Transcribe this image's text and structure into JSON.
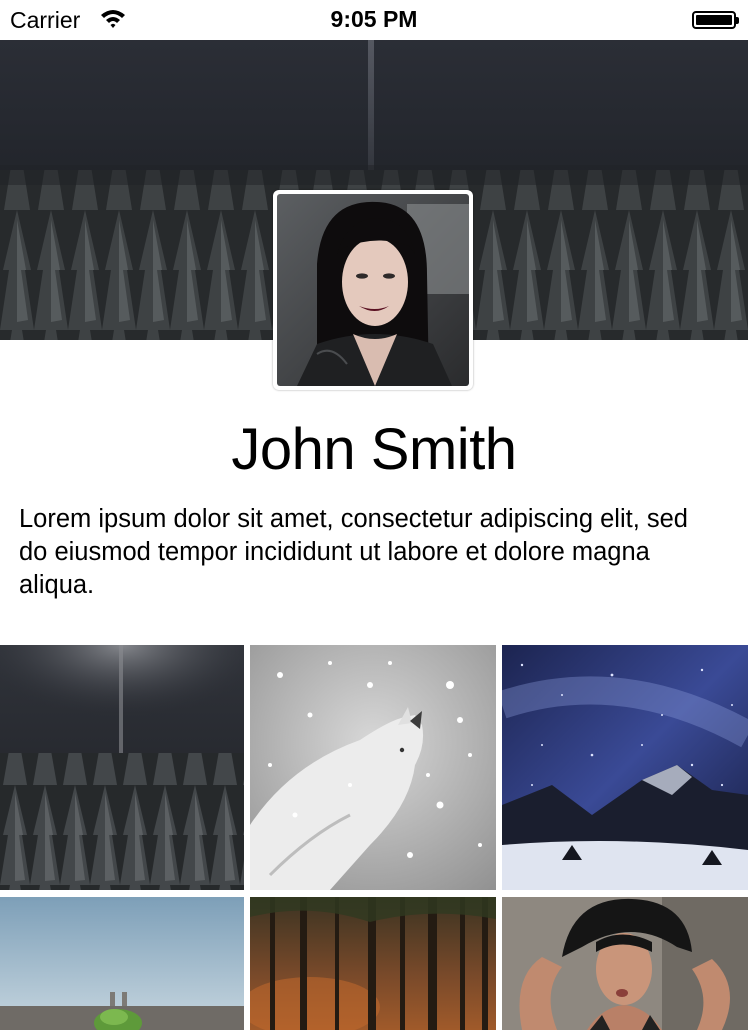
{
  "status_bar": {
    "carrier": "Carrier",
    "time": "9:05 PM",
    "wifi_icon": "wifi-icon",
    "battery_icon": "battery-icon",
    "battery_level_percent": 100
  },
  "profile": {
    "cover_image": "snowy-forest-night",
    "avatar_image": "woman-portrait",
    "name": "John Smith",
    "bio": "Lorem ipsum dolor sit amet, consectetur adipiscing elit, sed do eiusmod tempor incididunt ut labore et dolore magna aliqua."
  },
  "photos": [
    {
      "subject": "snowy-forest-night"
    },
    {
      "subject": "cat-in-snow"
    },
    {
      "subject": "starry-night-mountains"
    },
    {
      "subject": "building-sky"
    },
    {
      "subject": "autumn-forest"
    },
    {
      "subject": "woman-hat"
    }
  ],
  "colors": {
    "background": "#ffffff",
    "text": "#000000"
  }
}
